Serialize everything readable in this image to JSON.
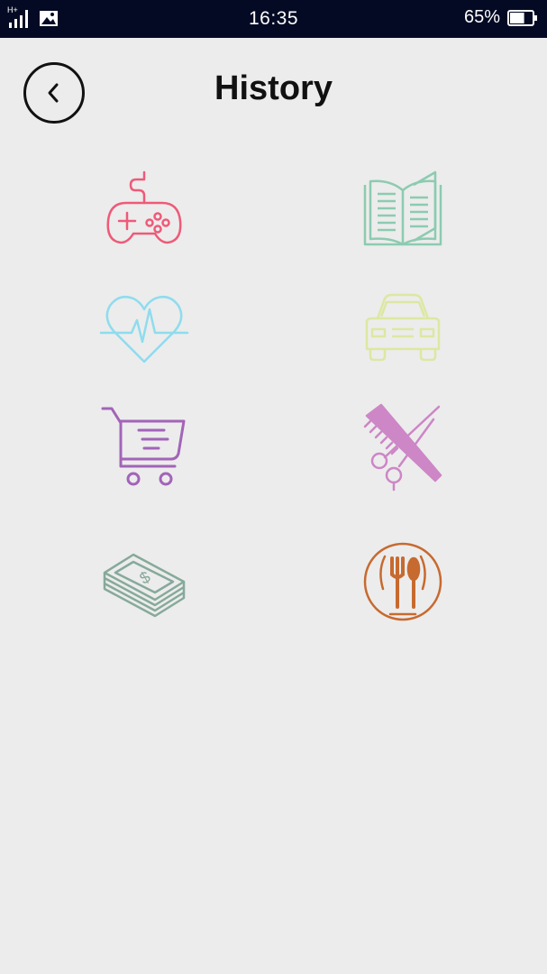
{
  "status_bar": {
    "network_type": "H+",
    "time": "16:35",
    "battery_percent": "65%",
    "battery_level": 0.65
  },
  "header": {
    "title": "History"
  },
  "categories": [
    {
      "id": "games",
      "icon": "gamepad-icon",
      "color": "#ee5a78"
    },
    {
      "id": "books",
      "icon": "open-book-icon",
      "color": "#8ccbb0"
    },
    {
      "id": "health",
      "icon": "heart-pulse-icon",
      "color": "#8fdcee"
    },
    {
      "id": "car",
      "icon": "car-icon",
      "color": "#dde7a2"
    },
    {
      "id": "shopping",
      "icon": "shopping-cart-icon",
      "color": "#a264b8"
    },
    {
      "id": "salon",
      "icon": "comb-scissors-icon",
      "color": "#cd86c6"
    },
    {
      "id": "money",
      "icon": "money-stack-icon",
      "color": "#86a99a"
    },
    {
      "id": "food",
      "icon": "fork-spoon-plate-icon",
      "color": "#c76a2f"
    }
  ]
}
